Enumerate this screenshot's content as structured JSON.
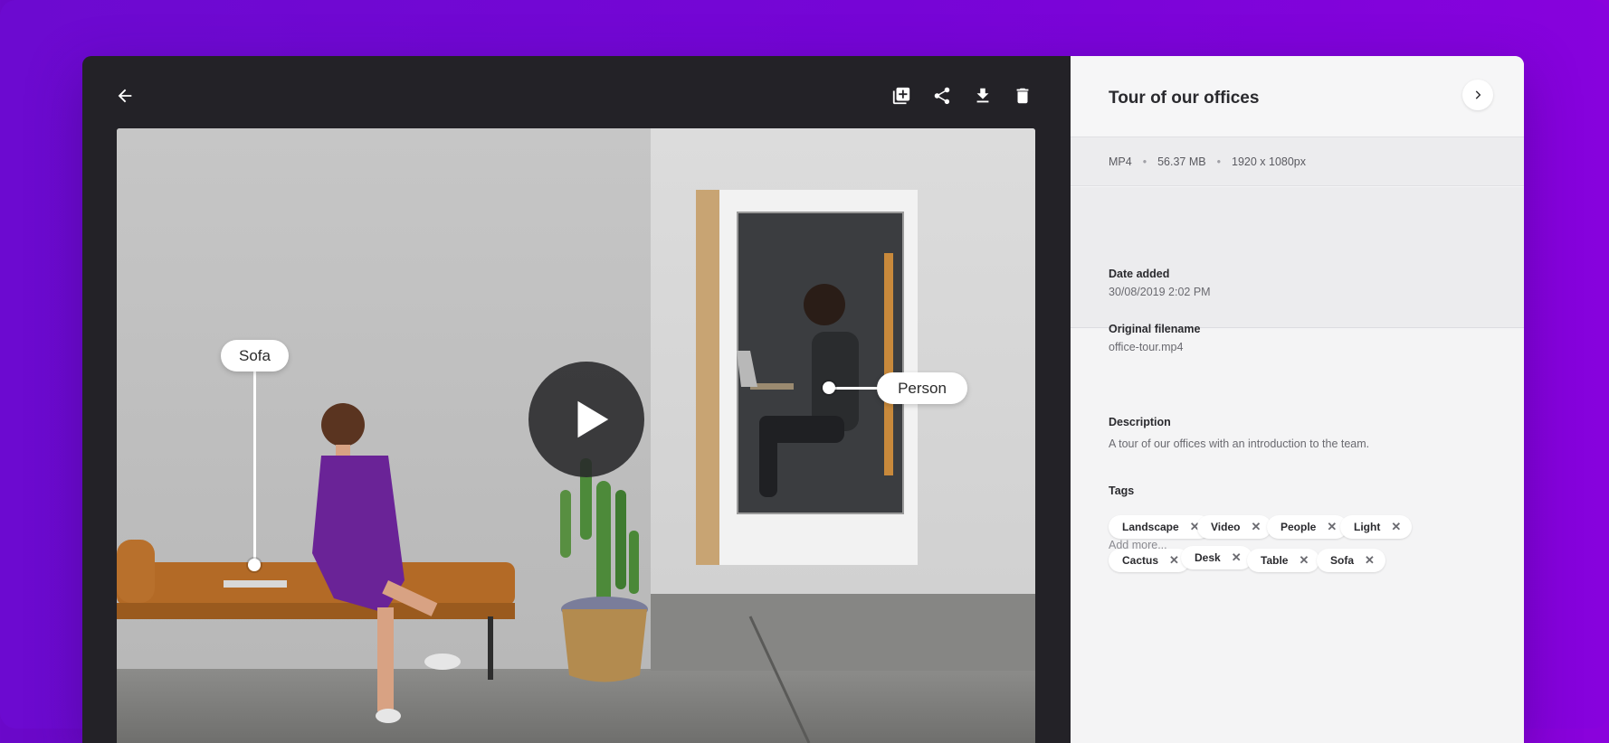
{
  "toolbar": {
    "back_icon": "arrow-left-icon",
    "actions": [
      "add-to-collection-icon",
      "share-icon",
      "download-icon",
      "delete-icon"
    ]
  },
  "media": {
    "play_icon": "play-icon",
    "annotations": [
      {
        "label": "Sofa"
      },
      {
        "label": "Person"
      }
    ]
  },
  "sidebar": {
    "title": "Tour of our offices",
    "next_icon": "chevron-right-icon",
    "meta": {
      "format": "MP4",
      "size": "56.37 MB",
      "dimensions": "1920 x 1080px"
    },
    "date_added_label": "Date added",
    "date_added": "30/08/2019 2:02 PM",
    "filename_label": "Original filename",
    "filename": "office-tour.mp4",
    "description_label": "Description",
    "description": "A tour of our offices with an introduction to the team.",
    "tags_label": "Tags",
    "tags": [
      "Landscape",
      "Video",
      "People",
      "Light",
      "Cactus",
      "Desk",
      "Table",
      "Sofa"
    ],
    "tag_remove": "✕",
    "add_more": "Add more...",
    "meta_separator": "•"
  },
  "colors": {
    "background_gradient_start": "#6a08c9",
    "background_gradient_end": "#8a02dc",
    "viewer_bg": "#232227",
    "sidebar_bg": "#f4f4f5"
  }
}
